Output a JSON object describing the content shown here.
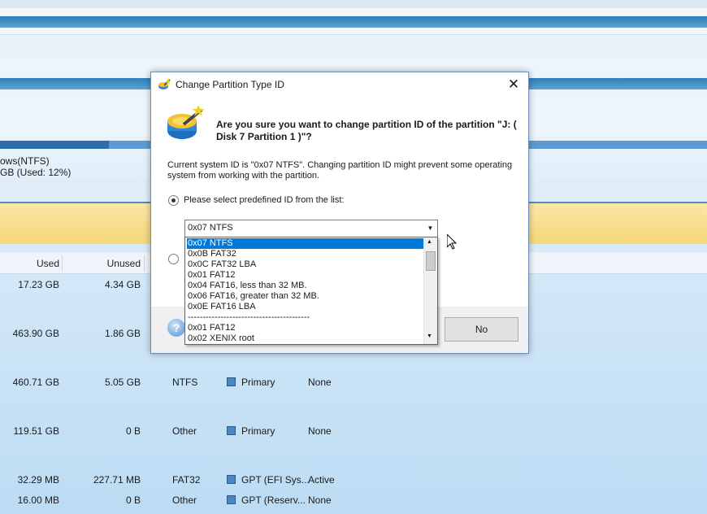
{
  "background": {
    "partition_left_label": "ows(NTFS)",
    "partition_left_usage": "GB (Used: 12%)",
    "columns": {
      "used": "Used",
      "unused": "Unused"
    },
    "rows": [
      {
        "used": "17.23 GB",
        "unused": "4.34 GB",
        "fs": "",
        "type": "",
        "status": ""
      },
      {
        "used": "463.90 GB",
        "unused": "1.86 GB",
        "fs": "",
        "type": "",
        "status": ""
      },
      {
        "used": "460.71 GB",
        "unused": "5.05 GB",
        "fs": "NTFS",
        "type": "Primary",
        "status": "None"
      },
      {
        "used": "119.51 GB",
        "unused": "0 B",
        "fs": "Other",
        "type": "Primary",
        "status": "None"
      },
      {
        "used": "32.29 MB",
        "unused": "227.71 MB",
        "fs": "FAT32",
        "type": "GPT (EFI Sys...",
        "status": "Active"
      },
      {
        "used": "16.00 MB",
        "unused": "0 B",
        "fs": "Other",
        "type": "GPT (Reserv...",
        "status": "None"
      }
    ]
  },
  "dialog": {
    "title": "Change Partition Type ID",
    "question": "Are you sure you want to change partition ID of the partition \"J: ( Disk 7 Partition 1 )\"?",
    "info": "Current system ID is \"0x07 NTFS\". Changing partition ID might prevent some operating system from working with the partition.",
    "radio_predefined_label": "Please select predefined ID from the list:",
    "selected_id": "0x07 NTFS",
    "options": [
      "0x07 NTFS",
      "0x0B FAT32",
      "0x0C FAT32 LBA",
      "0x01 FAT12",
      "0x04 FAT16, less than 32 MB.",
      "0x06 FAT16, greater than 32 MB.",
      "0x0E FAT16 LBA",
      "-----------------------------------------",
      "0x01 FAT12",
      "0x02 XENIX root"
    ],
    "no_label": "No",
    "icons": {
      "app": "wand-disk-icon",
      "help": "help-icon",
      "close": "close-icon"
    },
    "colors": {
      "selection": "#0078d7"
    }
  }
}
